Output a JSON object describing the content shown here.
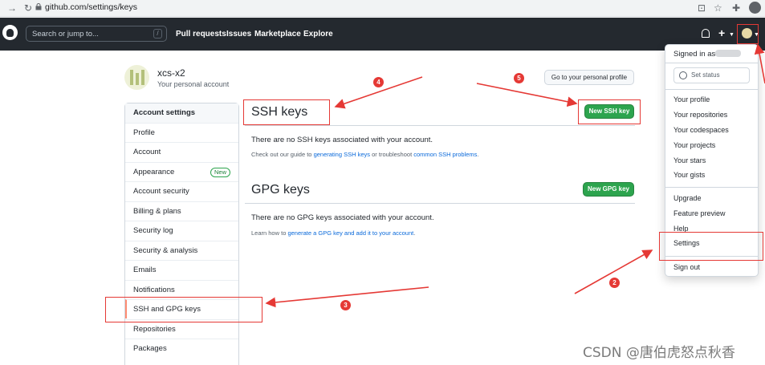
{
  "browser": {
    "url": "github.com/settings/keys",
    "back_icon": "back-arrow",
    "reload_icon": "reload"
  },
  "header": {
    "search_placeholder": "Search or jump to...",
    "search_shortcut": "/",
    "nav": [
      "Pull requests",
      "Issues",
      "Marketplace",
      "Explore"
    ],
    "plus_label": "+"
  },
  "profile": {
    "name": "xcs-x2",
    "subtitle": "Your personal account",
    "go_button": "Go to your personal profile"
  },
  "sidebar": {
    "heading": "Account settings",
    "items": [
      {
        "label": "Profile"
      },
      {
        "label": "Account"
      },
      {
        "label": "Appearance",
        "badge": "New"
      },
      {
        "label": "Account security"
      },
      {
        "label": "Billing & plans"
      },
      {
        "label": "Security log"
      },
      {
        "label": "Security & analysis"
      },
      {
        "label": "Emails"
      },
      {
        "label": "Notifications"
      },
      {
        "label": "SSH and GPG keys"
      },
      {
        "label": "Repositories"
      },
      {
        "label": "Packages"
      }
    ]
  },
  "ssh": {
    "title": "SSH keys",
    "button": "New SSH key",
    "empty": "There are no SSH keys associated with your account.",
    "help_prefix": "Check out our guide to ",
    "help_link1": "generating SSH keys",
    "help_middle": " or troubleshoot ",
    "help_link2": "common SSH problems",
    "help_suffix": "."
  },
  "gpg": {
    "title": "GPG keys",
    "button": "New GPG key",
    "empty": "There are no GPG keys associated with your account.",
    "help_prefix": "Learn how to ",
    "help_link": "generate a GPG key and add it to your account",
    "help_suffix": "."
  },
  "dropdown": {
    "signed_in": "Signed in as",
    "set_status": "Set status",
    "group1": [
      "Your profile",
      "Your repositories",
      "Your codespaces",
      "Your projects",
      "Your stars",
      "Your gists"
    ],
    "group2": [
      "Upgrade",
      "Feature preview",
      "Help",
      "Settings"
    ],
    "sign_out": "Sign out"
  },
  "annotations": {
    "markers": [
      "2",
      "3",
      "4",
      "5"
    ],
    "color": "#e53935"
  },
  "watermark": "CSDN @唐伯虎怒点秋香"
}
